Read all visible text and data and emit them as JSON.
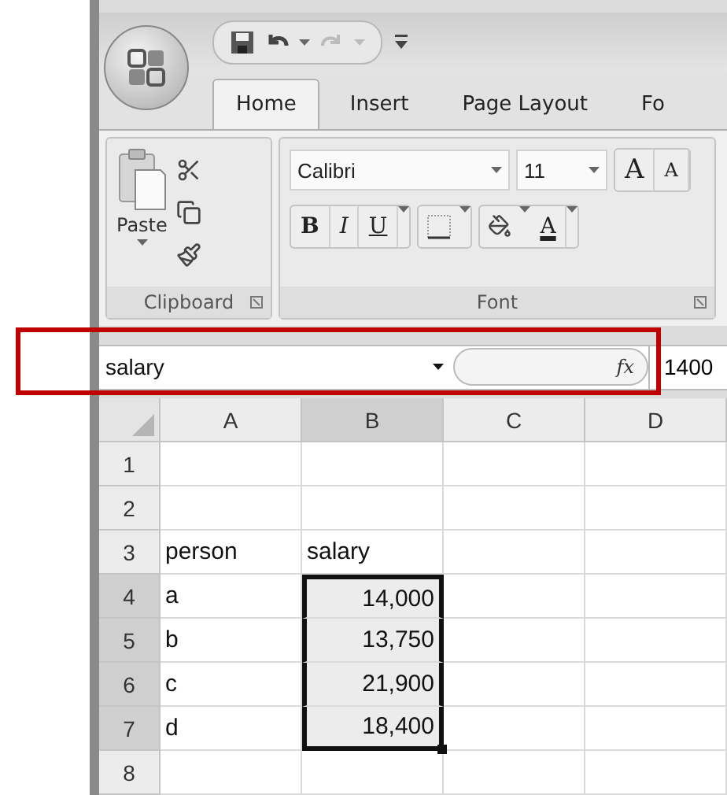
{
  "quick_access": {
    "undo_enabled": true,
    "redo_enabled": false
  },
  "tabs": [
    {
      "label": "Home",
      "selected": true
    },
    {
      "label": "Insert",
      "selected": false
    },
    {
      "label": "Page Layout",
      "selected": false
    },
    {
      "label": "Fo",
      "selected": false
    }
  ],
  "clipboard": {
    "paste_label": "Paste",
    "group_label": "Clipboard"
  },
  "font": {
    "font_name": "Calibri",
    "font_size": "11",
    "grow_label": "A",
    "shrink_label": "A",
    "bold_label": "B",
    "italic_label": "I",
    "underline_label": "U",
    "color_label": "A",
    "group_label": "Font"
  },
  "formula_bar": {
    "name_box": "salary",
    "fx_label": "fx",
    "value": "1400",
    "highlighted": true
  },
  "sheet": {
    "columns": [
      {
        "label": "A",
        "selected": false
      },
      {
        "label": "B",
        "selected": true
      },
      {
        "label": "C",
        "selected": false
      },
      {
        "label": "D",
        "selected": false
      }
    ],
    "rows": [
      {
        "label": "1",
        "selected": false,
        "cells": [
          {
            "selected": false
          },
          {
            "selected": false
          },
          {
            "selected": false
          },
          {
            "selected": false
          }
        ]
      },
      {
        "label": "2",
        "selected": false,
        "cells": [
          {
            "selected": false
          },
          {
            "selected": false
          },
          {
            "selected": false
          },
          {
            "selected": false
          }
        ]
      },
      {
        "label": "3",
        "selected": false,
        "cells": [
          {
            "text": "person",
            "kind": "text",
            "selected": false
          },
          {
            "text": "salary",
            "kind": "text",
            "selected": false
          },
          {
            "selected": false
          },
          {
            "selected": false
          }
        ]
      },
      {
        "label": "4",
        "selected": true,
        "cells": [
          {
            "text": "a",
            "kind": "text",
            "selected": false
          },
          {
            "text": "14,000",
            "kind": "number",
            "selected": true
          },
          {
            "selected": false
          },
          {
            "selected": false
          }
        ]
      },
      {
        "label": "5",
        "selected": true,
        "cells": [
          {
            "text": "b",
            "kind": "text",
            "selected": false
          },
          {
            "text": "13,750",
            "kind": "number",
            "selected": true
          },
          {
            "selected": false
          },
          {
            "selected": false
          }
        ]
      },
      {
        "label": "6",
        "selected": true,
        "cells": [
          {
            "text": "c",
            "kind": "text",
            "selected": false
          },
          {
            "text": "21,900",
            "kind": "number",
            "selected": true
          },
          {
            "selected": false
          },
          {
            "selected": false
          }
        ]
      },
      {
        "label": "7",
        "selected": true,
        "cells": [
          {
            "text": "d",
            "kind": "text",
            "selected": false
          },
          {
            "text": "18,400",
            "kind": "number",
            "selected": true
          },
          {
            "selected": false
          },
          {
            "selected": false
          }
        ]
      },
      {
        "label": "8",
        "selected": false,
        "cells": [
          {
            "selected": false
          },
          {
            "selected": false
          },
          {
            "selected": false
          },
          {
            "selected": false
          }
        ]
      }
    ]
  }
}
